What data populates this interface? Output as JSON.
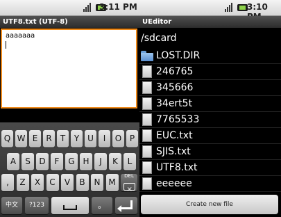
{
  "left": {
    "status": {
      "time": "3:11 PM"
    },
    "title": "UTF8.txt (UTF-8)",
    "editor": {
      "text": "aaaaaaa"
    },
    "keyboard": {
      "row1": [
        "Q",
        "W",
        "E",
        "R",
        "T",
        "Y",
        "U",
        "I",
        "O",
        "P"
      ],
      "row2": [
        "A",
        "S",
        "D",
        "F",
        "G",
        "H",
        "J",
        "K",
        "L"
      ],
      "row3": [
        ",",
        "Z",
        "X",
        "C",
        "V",
        "B",
        "N",
        "M"
      ],
      "del_label": "DEL",
      "lang_label": "中文",
      "sym_label": "?123",
      "period_label": "。"
    }
  },
  "right": {
    "status": {
      "time": "3:10 PM"
    },
    "title": "UEditor",
    "path": "/sdcard",
    "files": [
      {
        "name": "LOST.DIR",
        "icon": "folder-icon"
      },
      {
        "name": "246765",
        "icon": "file-icon"
      },
      {
        "name": "345666",
        "icon": "file-icon"
      },
      {
        "name": "34ert5t",
        "icon": "file-icon"
      },
      {
        "name": "7765533",
        "icon": "file-icon"
      },
      {
        "name": "EUC.txt",
        "icon": "file-icon"
      },
      {
        "name": "SJIS.txt",
        "icon": "file-icon"
      },
      {
        "name": "UTF8.txt",
        "icon": "file-icon"
      },
      {
        "name": "eeeeee",
        "icon": "file-icon"
      }
    ],
    "create_button": "Create new file"
  }
}
